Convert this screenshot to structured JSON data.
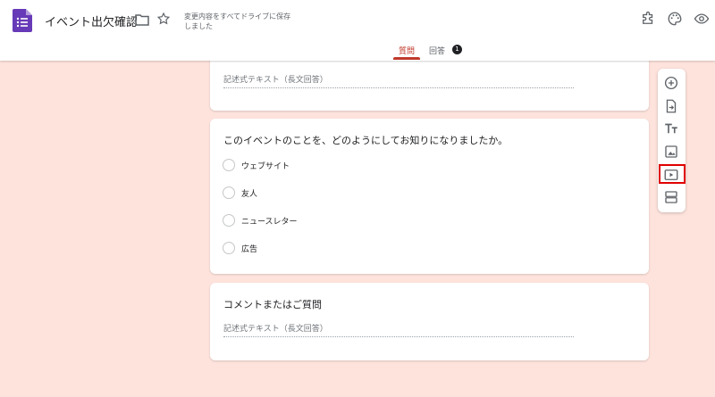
{
  "header": {
    "doc_title": "イベント出欠確認",
    "save_status": "変更内容をすべてドライブに保存しました",
    "brand_color": "#673ab7",
    "tabs": [
      {
        "label": "質問",
        "active": true
      },
      {
        "label": "回答",
        "badge": "1"
      }
    ]
  },
  "cards": {
    "first": {
      "placeholder": "記述式テキスト（長文回答）"
    },
    "question": {
      "title": "このイベントのことを、どのようにしてお知りになりましたか。",
      "options": [
        "ウェブサイト",
        "友人",
        "ニュースレター",
        "広告"
      ]
    },
    "comment": {
      "title": "コメントまたはご質問",
      "placeholder": "記述式テキスト（長文回答）"
    }
  },
  "toolbar": {
    "items": [
      "add-question-icon",
      "import-questions-icon",
      "add-title-icon",
      "add-image-icon",
      "add-video-icon",
      "add-section-icon"
    ],
    "highlighted": "add-video-icon",
    "highlight_color": "#e00000"
  },
  "background_color": "#fde3dc",
  "accent_color": "#c0392b"
}
